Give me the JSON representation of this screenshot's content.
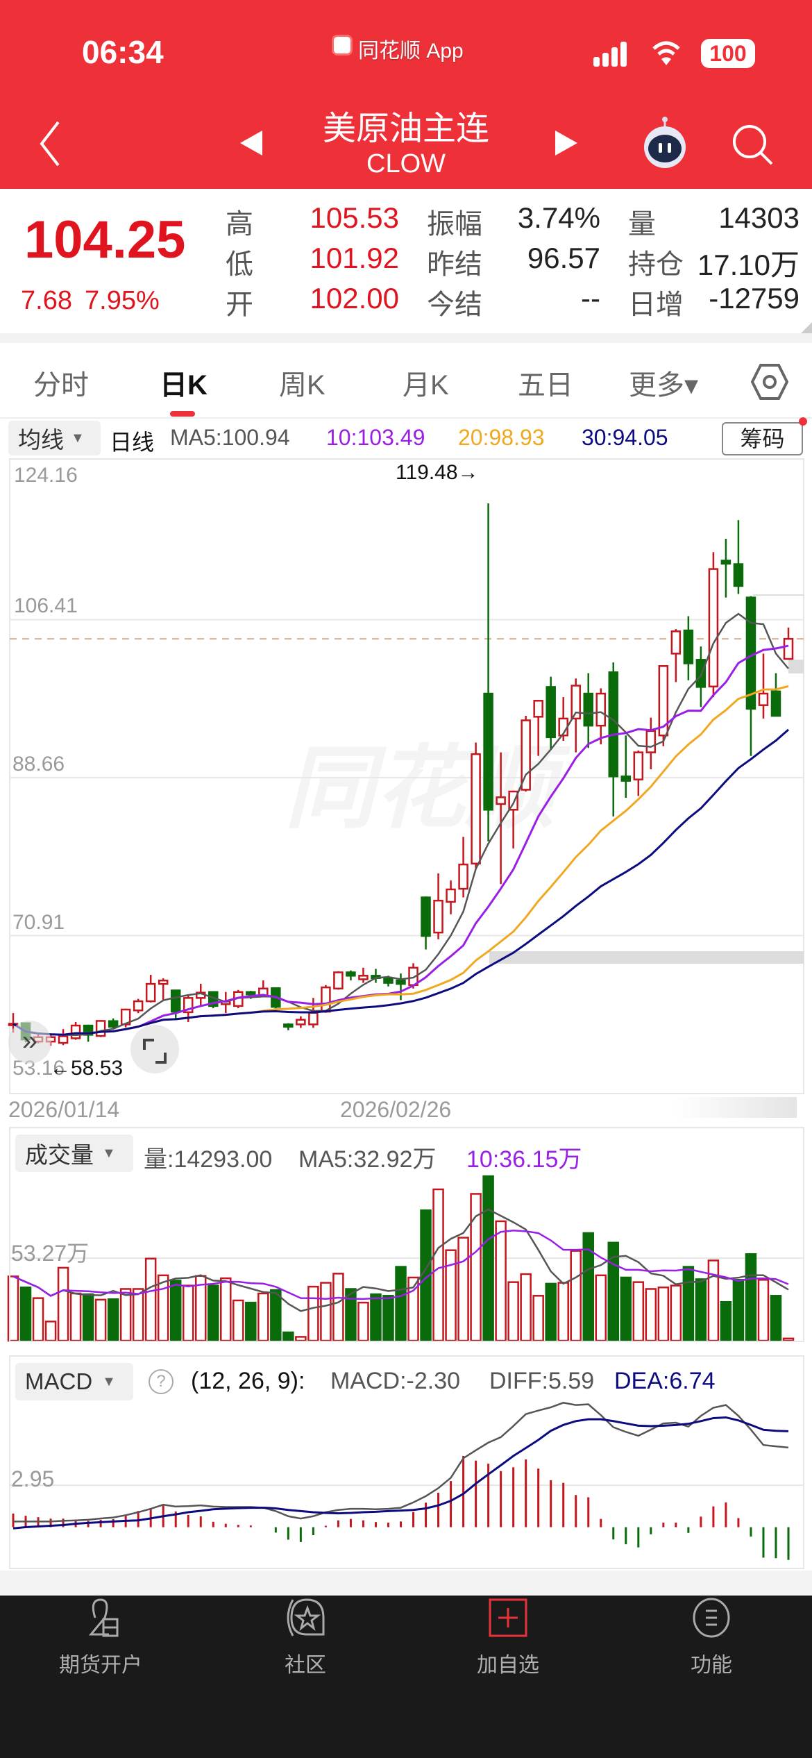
{
  "status_bar": {
    "time": "06:34",
    "app_name": "同花顺 App",
    "battery": "100"
  },
  "header": {
    "title": "美原油主连",
    "code": "CLOW"
  },
  "quote": {
    "price": "104.25",
    "change": "7.68",
    "change_pct": "7.95%",
    "rows": [
      {
        "l1": "高",
        "v1": "105.53",
        "l2": "振幅",
        "v2": "3.74%",
        "l3": "量",
        "v3": "14303"
      },
      {
        "l1": "低",
        "v1": "101.92",
        "l2": "昨结",
        "v2": "96.57",
        "l3": "持仓",
        "v3": "17.10万"
      },
      {
        "l1": "开",
        "v1": "102.00",
        "l2": "今结",
        "v2": "--",
        "l3": "日增",
        "v3": "-12759"
      }
    ]
  },
  "tabs": [
    {
      "label": "分时"
    },
    {
      "label": "日K"
    },
    {
      "label": "周K"
    },
    {
      "label": "月K"
    },
    {
      "label": "五日"
    },
    {
      "label": "更多▾"
    }
  ],
  "ma_legend": {
    "selector": "均线",
    "period": "日线",
    "ma5": "MA5:100.94",
    "ma10": "10:103.49",
    "ma20": "20:98.93",
    "ma30": "30:94.05",
    "chips_button": "筹码"
  },
  "price_axis": {
    "labels": [
      "124.16",
      "106.41",
      "88.66",
      "70.91",
      "53.16"
    ],
    "high_marker": "119.48→",
    "low_marker": "←58.53"
  },
  "dates": [
    "2026/01/14",
    "2026/02/26"
  ],
  "volume_legend": {
    "selector": "成交量",
    "vol": "量:14293.00",
    "ma5": "MA5:32.92万",
    "ma10": "10:36.15万",
    "axis_label": "53.27万"
  },
  "macd_legend": {
    "selector": "MACD",
    "help": "?",
    "params": "(12, 26, 9):",
    "macd": "MACD:-2.30",
    "diff": "DIFF:5.59",
    "dea": "DEA:6.74",
    "axis_label": "2.95"
  },
  "bottom_nav": [
    {
      "label": "期货开户"
    },
    {
      "label": "社区"
    },
    {
      "label": "加自选"
    },
    {
      "label": "功能"
    }
  ],
  "colors": {
    "brand_red": "#ee3039",
    "up": "#c4161c",
    "down": "#0a6b0a",
    "ma5": "#555555",
    "ma10": "#9a1fe6",
    "ma20": "#f0a820",
    "ma30": "#0c0c80"
  },
  "chart_data": {
    "type": "candlestick",
    "title": "美原油主连 CLOW 日K",
    "ylim": [
      53.16,
      124.16
    ],
    "yticks": [
      124.16,
      106.41,
      88.66,
      70.91,
      53.16
    ],
    "x_labels": {
      "0": "2026/01/14",
      "30": "2026/02/26"
    },
    "last_price": 104.25,
    "candles_ohlc": [
      [
        60.9,
        62.2,
        60.0,
        61.0
      ],
      [
        61.06,
        61.1,
        58.9,
        59.24
      ],
      [
        59.0,
        59.8,
        58.8,
        59.5
      ],
      [
        59.0,
        59.7,
        58.53,
        59.5
      ],
      [
        58.85,
        60.4,
        58.6,
        59.6
      ],
      [
        59.37,
        61.2,
        59.2,
        60.8
      ],
      [
        60.8,
        60.9,
        58.98,
        59.76
      ],
      [
        59.63,
        61.4,
        59.5,
        61.32
      ],
      [
        61.3,
        61.6,
        60.5,
        60.67
      ],
      [
        60.93,
        62.7,
        60.6,
        62.6
      ],
      [
        62.5,
        63.8,
        62.2,
        63.53
      ],
      [
        63.53,
        66.5,
        63.4,
        65.48
      ],
      [
        65.48,
        66.1,
        63.7,
        65.86
      ],
      [
        64.75,
        64.8,
        61.45,
        62.36
      ],
      [
        62.3,
        64.2,
        61.2,
        63.9
      ],
      [
        63.9,
        65.5,
        63.1,
        64.5
      ],
      [
        64.57,
        64.6,
        62.75,
        63.0
      ],
      [
        63.2,
        64.57,
        62.2,
        63.5
      ],
      [
        63.0,
        64.8,
        62.75,
        64.57
      ],
      [
        64.57,
        64.7,
        63.8,
        64.3
      ],
      [
        64.17,
        65.87,
        64.0,
        64.96
      ],
      [
        65.0,
        65.1,
        62.5,
        62.9
      ],
      [
        60.93,
        61.06,
        60.27,
        60.67
      ],
      [
        60.93,
        61.84,
        60.54,
        61.45
      ],
      [
        60.93,
        63.9,
        60.54,
        62.23
      ],
      [
        62.36,
        65.35,
        62.23,
        65.09
      ],
      [
        64.96,
        66.9,
        64.83,
        66.78
      ],
      [
        66.78,
        66.99,
        65.87,
        66.4
      ],
      [
        66.0,
        67.3,
        65.6,
        66.4
      ],
      [
        66.4,
        67.17,
        65.6,
        66.13
      ],
      [
        66.13,
        66.4,
        65.2,
        65.6
      ],
      [
        65.87,
        66.65,
        63.66,
        65.48
      ],
      [
        65.35,
        67.8,
        64.96,
        67.3
      ],
      [
        75.2,
        75.3,
        69.35,
        70.87
      ],
      [
        71.25,
        77.9,
        70.5,
        74.84
      ],
      [
        74.7,
        77.1,
        73.3,
        76.1
      ],
      [
        76.17,
        82.0,
        75.2,
        78.9
      ],
      [
        79.0,
        92.6,
        78.5,
        91.3
      ],
      [
        98.1,
        119.48,
        81.5,
        85.05
      ],
      [
        85.7,
        91.5,
        76.7,
        86.45
      ],
      [
        85.05,
        87.2,
        80.7,
        87.1
      ],
      [
        87.3,
        95.6,
        87.1,
        95.1
      ],
      [
        95.5,
        97.4,
        91.1,
        97.3
      ],
      [
        98.85,
        100.0,
        91.85,
        93.2
      ],
      [
        93.4,
        97.7,
        92.8,
        95.3
      ],
      [
        95.3,
        99.8,
        91.5,
        99.0
      ],
      [
        98.1,
        100.4,
        92.0,
        94.5
      ],
      [
        94.5,
        98.7,
        92.4,
        98.1
      ],
      [
        100.5,
        101.6,
        84.3,
        88.8
      ],
      [
        88.8,
        93.4,
        86.4,
        88.3
      ],
      [
        88.45,
        91.7,
        86.6,
        91.5
      ],
      [
        91.5,
        95.4,
        89.6,
        93.9
      ],
      [
        93.4,
        101.3,
        92.2,
        101.2
      ],
      [
        102.6,
        105.35,
        99.4,
        105.1
      ],
      [
        105.2,
        106.8,
        99.6,
        101.5
      ],
      [
        101.9,
        103.4,
        96.6,
        98.85
      ],
      [
        98.9,
        114.0,
        97.7,
        112.1
      ],
      [
        113.05,
        115.5,
        108.9,
        112.7
      ],
      [
        112.65,
        117.6,
        109.3,
        110.2
      ],
      [
        108.9,
        109.05,
        91.1,
        96.4
      ],
      [
        96.8,
        102.6,
        95.3,
        98.1
      ],
      [
        98.35,
        100.4,
        95.6,
        95.6
      ],
      [
        102.0,
        105.53,
        101.92,
        104.25
      ]
    ],
    "volume_wan": [
      41.5,
      34.4,
      27.5,
      12.4,
      47.1,
      30.5,
      30.0,
      26.5,
      26.8,
      33.4,
      33.4,
      53.0,
      42.2,
      38.8,
      35.6,
      41.8,
      35.6,
      40.3,
      26.0,
      24.6,
      30.5,
      32.7,
      5.4,
      2.5,
      34.9,
      37.4,
      43.3,
      33.4,
      24.6,
      30.0,
      29.0,
      47.7,
      40.8,
      84.2,
      97.7,
      58.4,
      66.5,
      94.8,
      106.2,
      77.1,
      37.8,
      43.0,
      29.0,
      36.8,
      37.4,
      58.0,
      69.5,
      42.2,
      63.3,
      40.8,
      37.8,
      33.4,
      34.4,
      35.6,
      47.7,
      39.7,
      51.8,
      25.0,
      39.3,
      55.9,
      39.3,
      29.0,
      1.43
    ],
    "volume_ylim": [
      0,
      108
    ],
    "volume_ytick": 53.27,
    "macd_diff": [
      0.4,
      0.4,
      0.4,
      0.4,
      0.45,
      0.48,
      0.52,
      0.61,
      0.68,
      0.84,
      1.05,
      1.29,
      1.58,
      1.45,
      1.48,
      1.53,
      1.45,
      1.42,
      1.42,
      1.42,
      1.37,
      1.13,
      0.77,
      0.61,
      0.77,
      1.05,
      1.21,
      1.29,
      1.29,
      1.26,
      1.29,
      1.37,
      1.74,
      2.18,
      2.74,
      3.47,
      4.84,
      5.4,
      5.94,
      6.32,
      7.1,
      7.94,
      8.19,
      8.42,
      8.74,
      8.58,
      8.63,
      7.87,
      7.02,
      6.69,
      6.42,
      6.85,
      7.29,
      7.34,
      7.06,
      7.82,
      8.39,
      8.58,
      7.82,
      6.85,
      5.77,
      5.68,
      5.59
    ],
    "macd_dea": [
      -0.08,
      0.0,
      0.05,
      0.1,
      0.15,
      0.24,
      0.3,
      0.35,
      0.4,
      0.45,
      0.48,
      0.62,
      0.77,
      0.9,
      1.05,
      1.15,
      1.26,
      1.3,
      1.34,
      1.36,
      1.37,
      1.32,
      1.21,
      1.13,
      1.05,
      1.0,
      0.97,
      1.0,
      1.05,
      1.08,
      1.13,
      1.17,
      1.21,
      1.32,
      1.53,
      1.85,
      2.34,
      3.06,
      3.71,
      4.35,
      5.0,
      5.56,
      6.13,
      6.77,
      7.18,
      7.45,
      7.58,
      7.58,
      7.45,
      7.29,
      7.13,
      7.1,
      7.13,
      7.18,
      7.26,
      7.45,
      7.66,
      7.71,
      7.5,
      7.18,
      6.84,
      6.77,
      6.74
    ],
    "macd_ylim": [
      -2.85,
      9.0
    ],
    "macd_ytick": 2.95
  }
}
